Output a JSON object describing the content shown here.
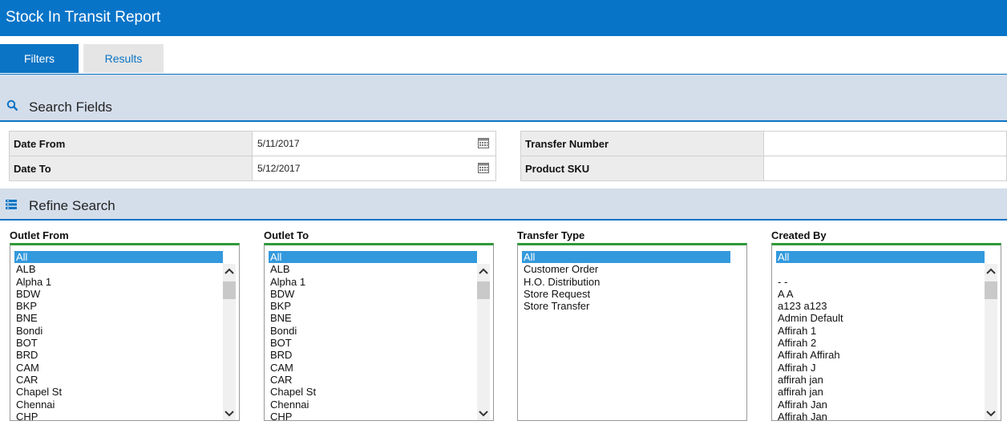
{
  "title": "Stock In Transit Report",
  "tabs": [
    {
      "label": "Filters",
      "active": true
    },
    {
      "label": "Results",
      "active": false
    }
  ],
  "sections": {
    "search_fields": "Search Fields",
    "refine_search": "Refine Search"
  },
  "search": {
    "date_from_label": "Date From",
    "date_from_value": "5/11/2017",
    "date_to_label": "Date To",
    "date_to_value": "5/12/2017",
    "transfer_number_label": "Transfer Number",
    "transfer_number_value": "",
    "product_sku_label": "Product SKU",
    "product_sku_value": ""
  },
  "lists": [
    {
      "name": "outlet-from",
      "header": "Outlet From",
      "items": [
        "All",
        "ALB",
        "Alpha 1",
        "BDW",
        "BKP",
        "BNE",
        "Bondi",
        "BOT",
        "BRD",
        "CAM",
        "CAR",
        "Chapel St",
        "Chennai",
        "CHP"
      ],
      "selected": 0,
      "scrollbar": true
    },
    {
      "name": "outlet-to",
      "header": "Outlet To",
      "items": [
        "All",
        "ALB",
        "Alpha 1",
        "BDW",
        "BKP",
        "BNE",
        "Bondi",
        "BOT",
        "BRD",
        "CAM",
        "CAR",
        "Chapel St",
        "Chennai",
        "CHP"
      ],
      "selected": 0,
      "scrollbar": true
    },
    {
      "name": "transfer-type",
      "header": "Transfer Type",
      "items": [
        "All",
        "Customer Order",
        "H.O. Distribution",
        "Store Request",
        "Store Transfer"
      ],
      "selected": 0,
      "scrollbar": false
    },
    {
      "name": "created-by",
      "header": "Created By",
      "items": [
        "All",
        "",
        "- -",
        "A A",
        "a123 a123",
        "Admin Default",
        "Affirah 1",
        "Affirah 2",
        "Affirah Affirah",
        "Affirah J",
        "affirah jan",
        "affirah jan",
        "Affirah Jan",
        "Affirah Jan"
      ],
      "selected": 0,
      "scrollbar": true
    }
  ],
  "colors": {
    "brand_blue": "#0774c8",
    "band": "#d4deeb",
    "selection": "#3399dd",
    "list_top_border": "#2e9a3a"
  }
}
